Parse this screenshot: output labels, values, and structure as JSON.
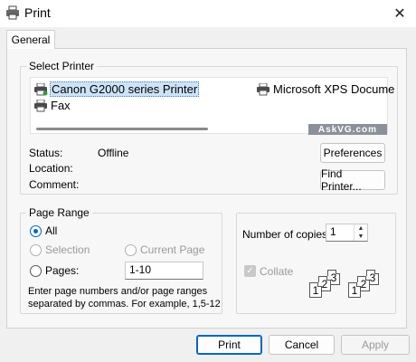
{
  "window": {
    "title": "Print"
  },
  "tabs": [
    {
      "label": "General"
    }
  ],
  "select_printer": {
    "group_label": "Select Printer",
    "printers": [
      {
        "name": "Canon G2000 series Printer",
        "selected": true
      },
      {
        "name": "Microsoft XPS Docume"
      },
      {
        "name": "Fax"
      }
    ],
    "watermark": "AskVG.com"
  },
  "printer_info": {
    "status_label": "Status:",
    "status_value": "Offline",
    "location_label": "Location:",
    "comment_label": "Comment:",
    "preferences_button": "Preferences",
    "find_printer_button": "Find Printer..."
  },
  "page_range": {
    "group_label": "Page Range",
    "all": "All",
    "selection": "Selection",
    "current_page": "Current Page",
    "pages": "Pages:",
    "pages_value": "1-10",
    "hint_line1": "Enter page numbers and/or page ranges",
    "hint_line2": "separated by commas.  For example, 1,5-12"
  },
  "copies": {
    "number_label": "Number of copies:",
    "number_value": "1",
    "collate_label": "Collate",
    "collate_checked": true
  },
  "collate_pages": {
    "set1": [
      "1",
      "2",
      "3"
    ],
    "set2": [
      "1",
      "2",
      "3"
    ]
  },
  "buttons": {
    "print": "Print",
    "cancel": "Cancel",
    "apply": "Apply"
  }
}
